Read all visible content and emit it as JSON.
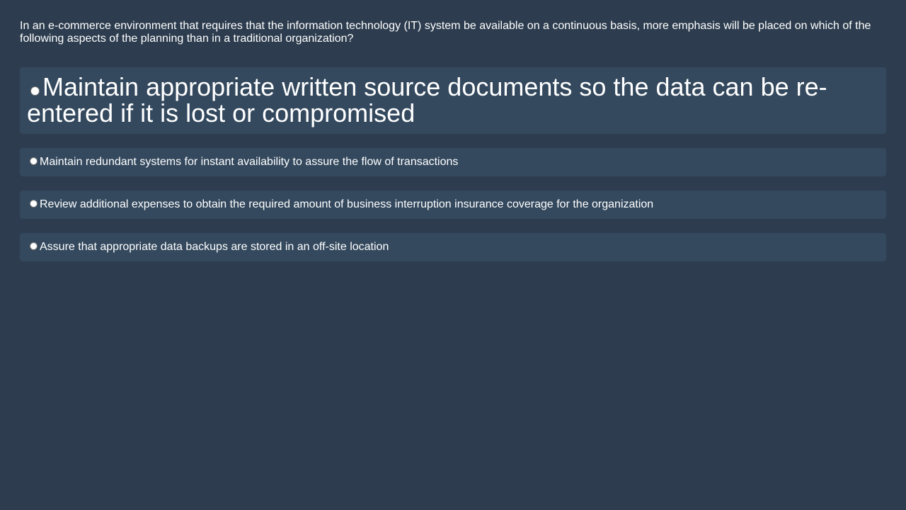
{
  "quiz": {
    "question": "In an e-commerce environment that requires that the information technology (IT) system be available on a continuous basis, more emphasis will be placed on which of the following aspects of the planning than in a traditional organization?",
    "options": [
      {
        "label": "Maintain appropriate written source documents so the data can be re-entered if it is lost or compromised"
      },
      {
        "label": "Maintain redundant systems for instant availability to assure the flow of transactions"
      },
      {
        "label": "Review additional expenses to obtain the required amount of business interruption insurance coverage for the organization"
      },
      {
        "label": "Assure that appropriate data backups are stored in an off-site location"
      }
    ]
  },
  "colors": {
    "background": "#2d3d4f",
    "option_background": "#34495e",
    "text": "#ffffff"
  }
}
